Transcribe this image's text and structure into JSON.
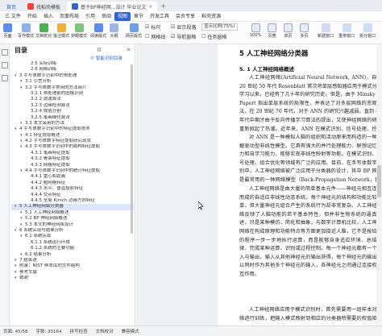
{
  "tabs": [
    {
      "label": "首页",
      "kind": "home"
    },
    {
      "label": "找稻壳模板",
      "kind": "template"
    },
    {
      "label": "基于BP神经网...设计 毕业论文",
      "kind": "doc"
    }
  ],
  "menu": [
    "三 文件",
    "开始",
    "插入",
    "页面布局",
    "引用",
    "审阅",
    "视图",
    "章节",
    "开发工具",
    "会员专享",
    "稻壳资源"
  ],
  "active_menu": "视图",
  "ribbon": {
    "buttons": [
      "阅读版式",
      "写作模式",
      "全屏显示",
      "阅读版式",
      "大纲",
      "网页版式"
    ],
    "left_labels": [
      "页面",
      "写作模式",
      "文档校对",
      "批注模式",
      "护眼模式"
    ],
    "checkboxes": [
      "标尺",
      "显示段落",
      "导航窗格",
      "任务窗格",
      "网格线"
    ],
    "zoom_select": "显示比例(75%)",
    "zoom_value": "100%",
    "right_labels": [
      "页宽",
      "单页",
      "多页",
      "新建窗口",
      "重排窗口",
      "拆分窗口"
    ]
  },
  "sidebar": {
    "title": "目录",
    "smart_toc": "智能识别目录",
    "items": [
      {
        "label": "2.5  实际训练",
        "level": 3
      },
      {
        "label": "2.6  网络训练",
        "level": 3
      },
      {
        "label": "3  手写体数字识别中的预处理",
        "level": 1
      },
      {
        "label": "3.1  引言分析",
        "level": 2
      },
      {
        "label": "3.2  手写体数字常用的方法简介",
        "level": 2
      },
      {
        "label": "3.2.1  预处理前的图像识别",
        "level": 3
      },
      {
        "label": "3.2.2  滤波算法",
        "level": 3
      },
      {
        "label": "3.2.3  边缘检测算法",
        "level": 3
      },
      {
        "label": "3.2.4  阈值分割",
        "level": 3
      },
      {
        "label": "3.2.5  笔画细化算法",
        "level": 3
      },
      {
        "label": "3.3  本文采用的方法",
        "level": 2
      },
      {
        "label": "4  手写体数字识别中的特征提取技术",
        "level": 1
      },
      {
        "label": "4.1  特征提取概述",
        "level": 2
      },
      {
        "label": "4.2  手写体数字特征提取研究现状",
        "level": 2
      },
      {
        "label": "4.3  手写体数字识别中的结构特征提取",
        "level": 2
      },
      {
        "label": "4.3.1  笔画特征提取",
        "level": 3
      },
      {
        "label": "4.3.2  骨架特征提取",
        "level": 3
      },
      {
        "label": "4.3.3  网格特征提取",
        "level": 3
      },
      {
        "label": "4.4  手写体数字识别中的统计特征提取",
        "level": 2
      },
      {
        "label": "4.4.1  重心和距离",
        "level": 3
      },
      {
        "label": "4.4.2  粗网格特征",
        "level": 3
      },
      {
        "label": "4.4.3  水平、垂直投影特征",
        "level": 3
      },
      {
        "label": "4.4.4  交点特征",
        "level": 3
      },
      {
        "label": "4.4.5  全局 Kirsch 边缘方向特征",
        "level": 3
      },
      {
        "label": "5  人工神经网络分类器",
        "level": 1,
        "selected": true
      },
      {
        "label": "5.1  人工神经网络概述",
        "level": 2
      },
      {
        "label": "5.2  BP 神经网络概述",
        "level": 2
      },
      {
        "label": "5.3  本文的神经网络设计",
        "level": 2
      },
      {
        "label": "6  系统实现与结果分析",
        "level": 1
      },
      {
        "label": "6.1  系统实现",
        "level": 2
      },
      {
        "label": "6.1.1  系统运行环境",
        "level": 3
      },
      {
        "label": "6.1.2  系统的主要功能",
        "level": 3
      },
      {
        "label": "6.2  结果分析",
        "level": 2
      },
      {
        "label": "7  结束语",
        "level": 1
      },
      {
        "label": "附录：NIST 样本库的文件结构",
        "level": 1
      },
      {
        "label": "参考文献",
        "level": 1
      },
      {
        "label": "致谢",
        "level": 1
      }
    ]
  },
  "document": {
    "heading": "5   人工神经网络分类器",
    "subheading": "5. 1   人工神经网络概述",
    "para1": "人工神经网络(Artificial Neural Network, ANN)，自从 20 世纪 50 年代 Rosenblatt 首次将单层感知器应用于模式分类学习以来，已经有了几十年的研究历史。但是，由于 Minsky 和 Papert 指出单层系统的局限性，并表达了对多层网络的悲观看法，在 20 世纪 70 年代，对于 ANN 的研究兴趣减弱。直到 80 年代中期才由于反向传播学习算法的提出，又使神经网络的研究重新掀起了热潮。近年来，ANN 在模式识别、信号处理、控制和优化等领域得到了广泛的应用。",
    "para2": "对 ANN 是一种模拟人脑的组织和活动原来而构造的一种数据驱动型非线性模型。它具有强大的并行处理能力、联想记忆能力和自学习能力，能够实现非线性映射等功能。在模式识别、信号处理、组合优化等领域有广泛的应用。目前，在手写体数字识别中，人工神经网络被广泛应用于分类器的设计，其中 BP 网络是最常用的一种网络模型（Back-Propagation Network，BP 网络）。",
    "para3": "人工神经网络是由大量的简单基本元件——神经元相互连接而成的自适应非线性动态系统。每个神经元的结构和功能比较简单，但大量神经元组合产生的系统行为却非常复杂。人工神经网络反映了人脑功能的若干基本特性，但并非生物系统的逼真描述，只是某种模仿、简化和抽象。与数字计算机比较，人工神经网络在构成原理和功能特点等方面更加接近人脑，它不是按给定的程序一步一步地执行运算，而是能够自身适应环境、总结规律、完成某种运算、识别或过程控制。每一个神经元都有一个输入与输出，输入从其他神经元的输出获得，每个神经元的输出可以同时作为其他多个神经元的输入，各神经元之间通过连接权相互作用。",
    "para4": "人工神经网络应用于模式识别时，首先需要用一组样本对网络进行训练，把输入模式映射到相应的分类器所需要的权值矩阵中，网络训练完成后，便可以使用训练好的网络对未知模式进行识别。"
  },
  "status": {
    "page": "页面: 45/58",
    "words": "字数: 30164",
    "spell": "拼写检查",
    "proof": "文档校对",
    "compat": "兼容模式"
  }
}
